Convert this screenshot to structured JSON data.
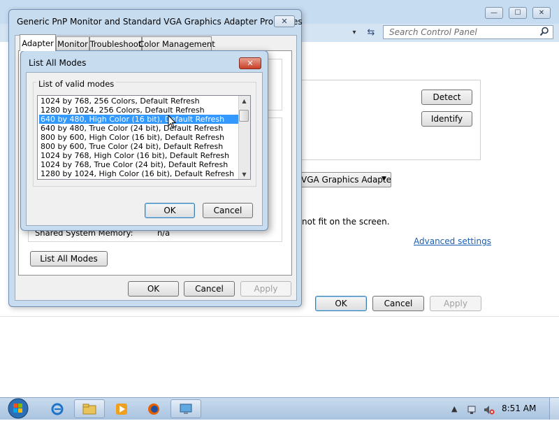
{
  "control_panel": {
    "search_placeholder": "Search Control Panel",
    "caption_minimize": "—",
    "caption_maximize": "☐",
    "caption_close": "✕",
    "nav_refresh": "⇆",
    "nav_dropdown": "▾",
    "buttons": {
      "detect": "Detect",
      "identify": "Identify",
      "ok": "OK",
      "cancel": "Cancel",
      "apply": "Apply"
    },
    "adapter_select_value": "VGA Graphics Adapter",
    "fit_text": "not fit on the screen.",
    "advanced_link": "Advanced settings"
  },
  "properties_dialog": {
    "title": "Generic PnP Monitor and Standard VGA Graphics Adapter Properties",
    "close_glyph": "✕",
    "tabs": [
      "Adapter",
      "Monitor",
      "Troubleshoot",
      "Color Management"
    ],
    "shared_memory_label": "Shared System Memory:",
    "shared_memory_value": "n/a",
    "list_all_modes_button": "List All Modes",
    "ok": "OK",
    "cancel": "Cancel",
    "apply": "Apply"
  },
  "modes_dialog": {
    "title": "List All Modes",
    "close_glyph": "✕",
    "group_label": "List of valid modes",
    "modes": [
      "1024 by 768, 256 Colors, Default Refresh",
      "1280 by 1024, 256 Colors, Default Refresh",
      "640 by 480, High Color (16 bit), Default Refresh",
      "640 by 480, True Color (24 bit), Default Refresh",
      "800 by 600, High Color (16 bit), Default Refresh",
      "800 by 600, True Color (24 bit), Default Refresh",
      "1024 by 768, High Color (16 bit), Default Refresh",
      "1024 by 768, True Color (24 bit), Default Refresh",
      "1280 by 1024, High Color (16 bit), Default Refresh"
    ],
    "selected_mode": "640 by 480, High Color (16 bit), Default Refresh",
    "scroll_up": "▲",
    "scroll_down": "▼",
    "ok": "OK",
    "cancel": "Cancel"
  },
  "taskbar": {
    "clock": "8:51 AM",
    "tray_arrow": "▲",
    "items": [
      "internet-explorer",
      "windows-explorer",
      "media-player",
      "firefox",
      "display-settings"
    ]
  },
  "colors": {
    "selection": "#3399ff",
    "title_bar": "#c8dcf0",
    "link": "#1a5fb4"
  }
}
